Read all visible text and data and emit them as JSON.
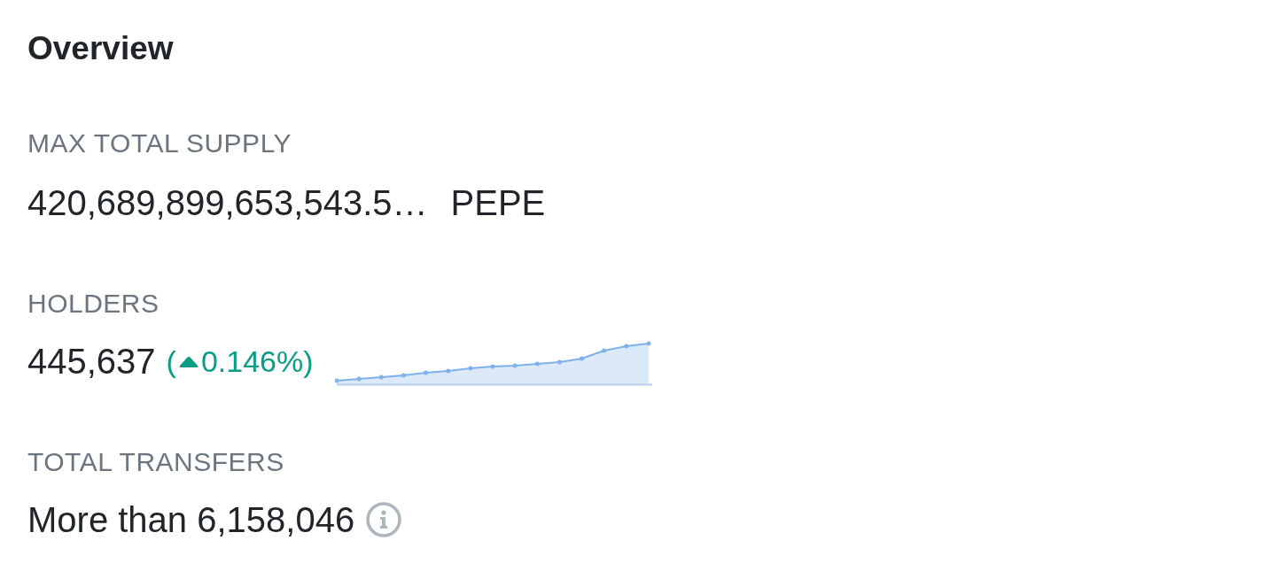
{
  "title": "Overview",
  "max_total_supply": {
    "label": "MAX TOTAL SUPPLY",
    "value": "420,689,899,653,543.5…",
    "symbol": "PEPE"
  },
  "holders": {
    "label": "HOLDERS",
    "value": "445,637",
    "change": {
      "open": "(",
      "value": "0.146%)",
      "rising": true
    }
  },
  "total_transfers": {
    "label": "TOTAL TRANSFERS",
    "value": "More than 6,158,046"
  }
}
